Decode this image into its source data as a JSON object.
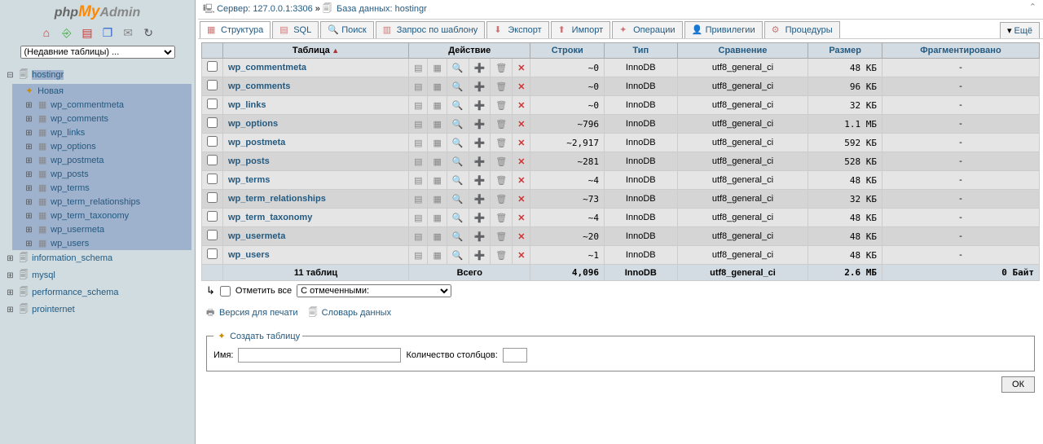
{
  "logo": {
    "php": "php",
    "my": "My",
    "admin": "Admin"
  },
  "recent_tables": "(Недавние таблицы) ...",
  "tree": {
    "current_db": "hostingr",
    "new_label": "Новая",
    "tables": [
      "wp_commentmeta",
      "wp_comments",
      "wp_links",
      "wp_options",
      "wp_postmeta",
      "wp_posts",
      "wp_terms",
      "wp_term_relationships",
      "wp_term_taxonomy",
      "wp_usermeta",
      "wp_users"
    ],
    "other_dbs": [
      "information_schema",
      "mysql",
      "performance_schema",
      "prointernet"
    ]
  },
  "breadcrumb": {
    "server_label": "Сервер: ",
    "server": "127.0.0.1:3306",
    "sep": "»",
    "db_label": "База данных: ",
    "db": "hostingr"
  },
  "tabs": {
    "structure": "Структура",
    "sql": "SQL",
    "search": "Поиск",
    "qbe": "Запрос по шаблону",
    "export": "Экспорт",
    "import": "Импорт",
    "operations": "Операции",
    "privileges": "Привилегии",
    "routines": "Процедуры",
    "more": "Ещё"
  },
  "headers": {
    "table": "Таблица",
    "action": "Действие",
    "rows": "Строки",
    "type": "Тип",
    "collation": "Сравнение",
    "size": "Размер",
    "overhead": "Фрагментировано"
  },
  "rows": [
    {
      "name": "wp_commentmeta",
      "rows": "~0",
      "type": "InnoDB",
      "coll": "utf8_general_ci",
      "size": "48 КБ",
      "over": "-"
    },
    {
      "name": "wp_comments",
      "rows": "~0",
      "type": "InnoDB",
      "coll": "utf8_general_ci",
      "size": "96 КБ",
      "over": "-"
    },
    {
      "name": "wp_links",
      "rows": "~0",
      "type": "InnoDB",
      "coll": "utf8_general_ci",
      "size": "32 КБ",
      "over": "-"
    },
    {
      "name": "wp_options",
      "rows": "~796",
      "type": "InnoDB",
      "coll": "utf8_general_ci",
      "size": "1.1 МБ",
      "over": "-"
    },
    {
      "name": "wp_postmeta",
      "rows": "~2,917",
      "type": "InnoDB",
      "coll": "utf8_general_ci",
      "size": "592 КБ",
      "over": "-"
    },
    {
      "name": "wp_posts",
      "rows": "~281",
      "type": "InnoDB",
      "coll": "utf8_general_ci",
      "size": "528 КБ",
      "over": "-"
    },
    {
      "name": "wp_terms",
      "rows": "~4",
      "type": "InnoDB",
      "coll": "utf8_general_ci",
      "size": "48 КБ",
      "over": "-"
    },
    {
      "name": "wp_term_relationships",
      "rows": "~73",
      "type": "InnoDB",
      "coll": "utf8_general_ci",
      "size": "32 КБ",
      "over": "-"
    },
    {
      "name": "wp_term_taxonomy",
      "rows": "~4",
      "type": "InnoDB",
      "coll": "utf8_general_ci",
      "size": "48 КБ",
      "over": "-"
    },
    {
      "name": "wp_usermeta",
      "rows": "~20",
      "type": "InnoDB",
      "coll": "utf8_general_ci",
      "size": "48 КБ",
      "over": "-"
    },
    {
      "name": "wp_users",
      "rows": "~1",
      "type": "InnoDB",
      "coll": "utf8_general_ci",
      "size": "48 КБ",
      "over": "-"
    }
  ],
  "summary": {
    "count": "11 таблиц",
    "total": "Всего",
    "rows": "4,096",
    "type": "InnoDB",
    "coll": "utf8_general_ci",
    "size": "2.6 МБ",
    "over": "0 Байт"
  },
  "checkall": {
    "label": "Отметить все",
    "dropdown": "С отмеченными:"
  },
  "links": {
    "print": "Версия для печати",
    "dict": "Словарь данных"
  },
  "create": {
    "legend": "Создать таблицу",
    "name": "Имя:",
    "cols": "Количество столбцов:",
    "ok": "ОК"
  }
}
